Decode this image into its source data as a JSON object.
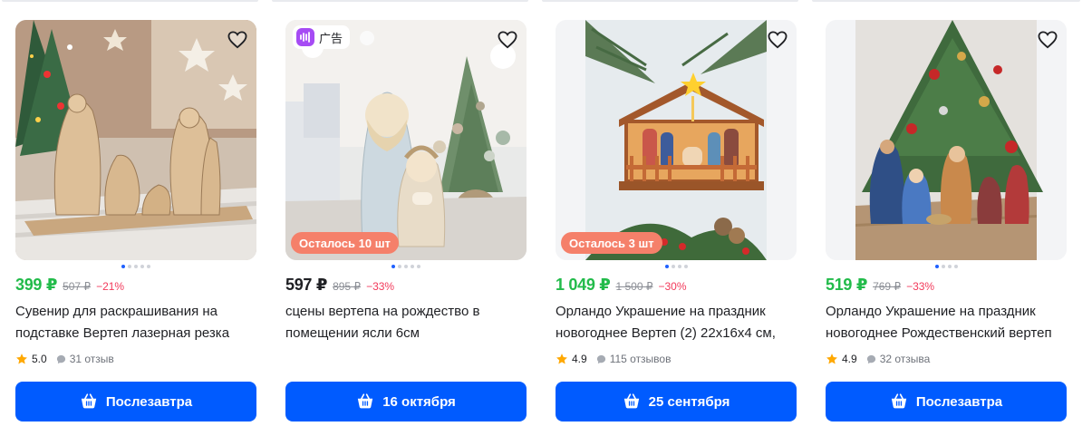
{
  "products": [
    {
      "price": "399 ₽",
      "old_price": "507 ₽",
      "discount": "−21%",
      "price_style": "sale",
      "title": "Сувенир для раскрашивания на подставке Вертеп лазерная резка",
      "rating": "5.0",
      "reviews": "31 отзыв",
      "delivery": "Послезавтра",
      "ad_label": "",
      "stock_label": "",
      "image_icon": "wooden-nativity-photo"
    },
    {
      "price": "597 ₽",
      "old_price": "895 ₽",
      "discount": "−33%",
      "price_style": "plain",
      "title": "сцены вертепа на рождество в помещении ясли 6см",
      "rating": "",
      "reviews": "",
      "delivery": "16 октября",
      "ad_label": "广告",
      "stock_label": "Осталось 10 шт",
      "image_icon": "ceramic-holy-family-photo"
    },
    {
      "price": "1 049 ₽",
      "old_price": "1 500 ₽",
      "discount": "−30%",
      "price_style": "sale",
      "title": "Орландо Украшение на праздник новогоднее Вертеп (2) 22х16х4 см,",
      "rating": "4.9",
      "reviews": "115 отзывов",
      "delivery": "25 сентября",
      "ad_label": "",
      "stock_label": "Осталось 3 шт",
      "image_icon": "wooden-stable-nativity-photo"
    },
    {
      "price": "519 ₽",
      "old_price": "769 ₽",
      "discount": "−33%",
      "price_style": "sale",
      "title": "Орландо Украшение на праздник новогоднее Рождественский вертеп",
      "rating": "4.9",
      "reviews": "32 отзыва",
      "delivery": "Послезавтра",
      "ad_label": "",
      "stock_label": "",
      "image_icon": "painted-figures-nativity-photo"
    }
  ],
  "colors": {
    "sale_price": "#22bb4a",
    "discount": "#f23a5b",
    "delivery_button": "#005bff",
    "stock_badge": "#f5806a",
    "star": "#ffa800"
  }
}
